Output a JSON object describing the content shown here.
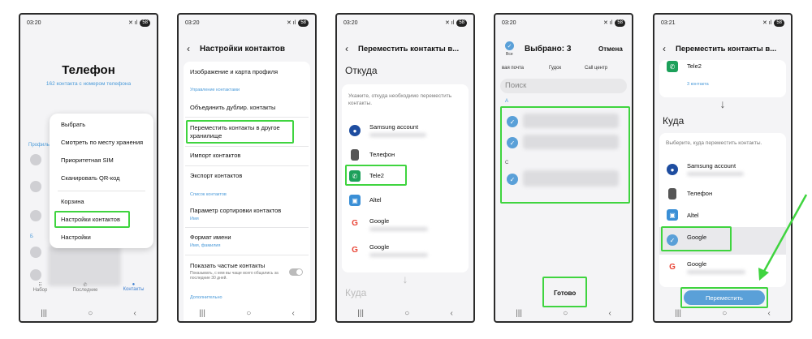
{
  "p1": {
    "time": "03:20",
    "signal": "✕ ıl",
    "batt": "58",
    "title": "Телефон",
    "subtitle": "162 контакта с номером телефона",
    "menu": [
      "Выбрать",
      "Смотреть по месту хранения",
      "Приоритетная SIM",
      "Сканировать QR-код",
      "Корзина",
      "Настройки контактов",
      "Настройки"
    ],
    "side_a": "Профиль",
    "side_b": "Б",
    "tabs": [
      "Набор",
      "Последние",
      "Контакты"
    ]
  },
  "p2": {
    "time": "03:20",
    "title": "Настройки контактов",
    "items": [
      "Изображение и карта профиля",
      "Управление контактами",
      "Объединить дублир. контакты",
      "Переместить контакты в другое хранилище",
      "Импорт контактов",
      "Экспорт контактов",
      "Список контактов",
      "Параметр сортировки контактов",
      "Имя",
      "Формат имени",
      "Имя, фамилия",
      "Показать частые контакты",
      "Показывать, с кем вы чаще всего общались за последние 30 дней.",
      "Дополнительно"
    ]
  },
  "p3": {
    "time": "03:20",
    "title": "Переместить контакты в...",
    "from": "Откуда",
    "hint": "Укажите, откуда необходимо переместить контакты.",
    "accounts": [
      "Samsung account",
      "Телефон",
      "Tele2",
      "Altel",
      "Google",
      "Google"
    ],
    "to": "Куда"
  },
  "p4": {
    "time": "03:20",
    "all": "Все",
    "selected": "Выбрано: 3",
    "cancel": "Отмена",
    "chips": [
      "вая почта",
      "Гудок",
      "Call центр"
    ],
    "search": "Поиск",
    "letter_a": "А",
    "letter_c": "С",
    "done": "Готово"
  },
  "p5": {
    "time": "03:21",
    "title": "Переместить контакты в...",
    "tele2": "Tele2",
    "count": "3 контакта",
    "to": "Куда",
    "hint": "Выберите, куда переместить контакты.",
    "accounts": [
      "Samsung account",
      "Телефон",
      "Altel",
      "Google",
      "Google"
    ],
    "move": "Переместить"
  },
  "colors": {
    "highlight": "#3fd43f",
    "accent": "#5aa0d8"
  }
}
